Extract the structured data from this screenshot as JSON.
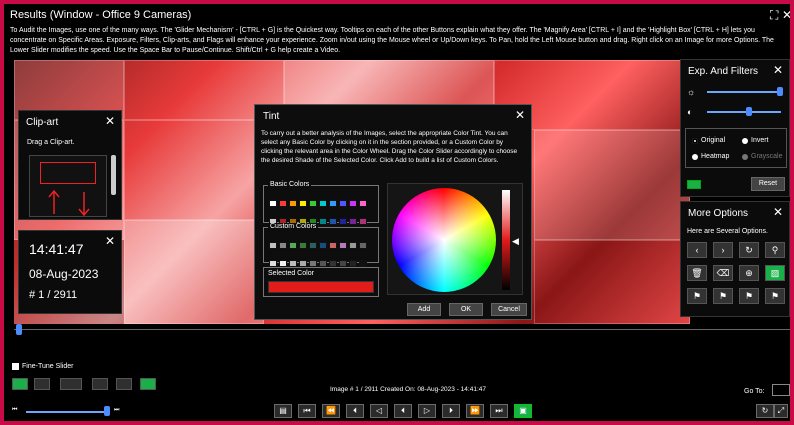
{
  "window": {
    "title": "Results (Window - Office 9 Cameras)",
    "fullscreen_icon": "fullscreen-icon",
    "close_icon": "close-icon"
  },
  "info_text": "To Audit the Images, use one of the many ways. The 'Glider Mechanism' - [CTRL + G] is the Quickest way. Tooltips on each of the other Buttons explain what they offer. The 'Magnify Area' [CTRL + I] and the 'Highlight Box' [CTRL + H] lets you concentrate on Specific Areas. Exposure, Filters, Clip-arts, and Flags will enhance your experience. Zoom in/out using the Mouse wheel or Up/Down keys. To Pan, hold the Left Mouse button and drag. Right click on an Image for more Options. The Lower Slider modifies the speed. Use the Space Bar to Pause/Continue. Shift/Ctrl + G help create a Video.",
  "clipart": {
    "title": "Clip-art",
    "hint": "Drag a Clip-art."
  },
  "timestamp": {
    "time": "14:41:47",
    "date": "08-Aug-2023",
    "index": "# 1 / 2911"
  },
  "tint": {
    "title": "Tint",
    "description": "To carry out a better analysis of the Images, select the appropriate Color Tint. You can select any Basic Color by clicking on it in the section provided, or a Custom Color by clicking the relevant area in the Color Wheel. Drag the Color Slider accordingly to choose the desired Shade of the Selected Color. Click Add to build a list of Custom Colors.",
    "basic_label": "Basic Colors",
    "custom_label": "Custom Colors",
    "selected_label": "Selected Color",
    "selected_color": "#e21b1b",
    "add_label": "Add",
    "ok_label": "OK",
    "cancel_label": "Cancel",
    "basic_colors": [
      "#ffffff",
      "#ff3a3a",
      "#ff9a00",
      "#ffee00",
      "#33cc33",
      "#00cccc",
      "#3399ff",
      "#5555ff",
      "#cc33ff",
      "#ff66cc",
      "#cccccc",
      "#aa2222",
      "#aa6600",
      "#aaaa00",
      "#228822",
      "#008888",
      "#2255aa",
      "#222299",
      "#772299",
      "#aa3377"
    ],
    "custom_colors": [
      "#c0c0c0",
      "#888888",
      "#55aa55",
      "#3a7a3a",
      "#2a6060",
      "#1b4a80",
      "#cc6666",
      "#bb77bb",
      "#999999",
      "#666666",
      "#dddddd",
      "#eeeeee",
      "#bbbbbb",
      "#aaaaaa",
      "#777777",
      "#555555",
      "#333333",
      "#444444",
      "#222222",
      "#111111"
    ]
  },
  "exp": {
    "title": "Exp. And Filters",
    "brightness": 1.0,
    "contrast": 0.55,
    "original_label": "Original",
    "invert_label": "Invert",
    "heatmap_label": "Heatmap",
    "grayscale_label": "Grayscale",
    "reset_label": "Reset"
  },
  "more": {
    "title": "More Options",
    "hint": "Here are Several Options."
  },
  "bottom": {
    "fine_tune_label": "Fine-Tune Slider",
    "image_info": "Image # 1 / 2911 Created On: 08-Aug-2023 - 14:41:47",
    "goto_label": "Go To:",
    "goto_value": ""
  },
  "colors": {
    "accent_green": "#19b04a",
    "border_magenta": "#c80a46"
  }
}
